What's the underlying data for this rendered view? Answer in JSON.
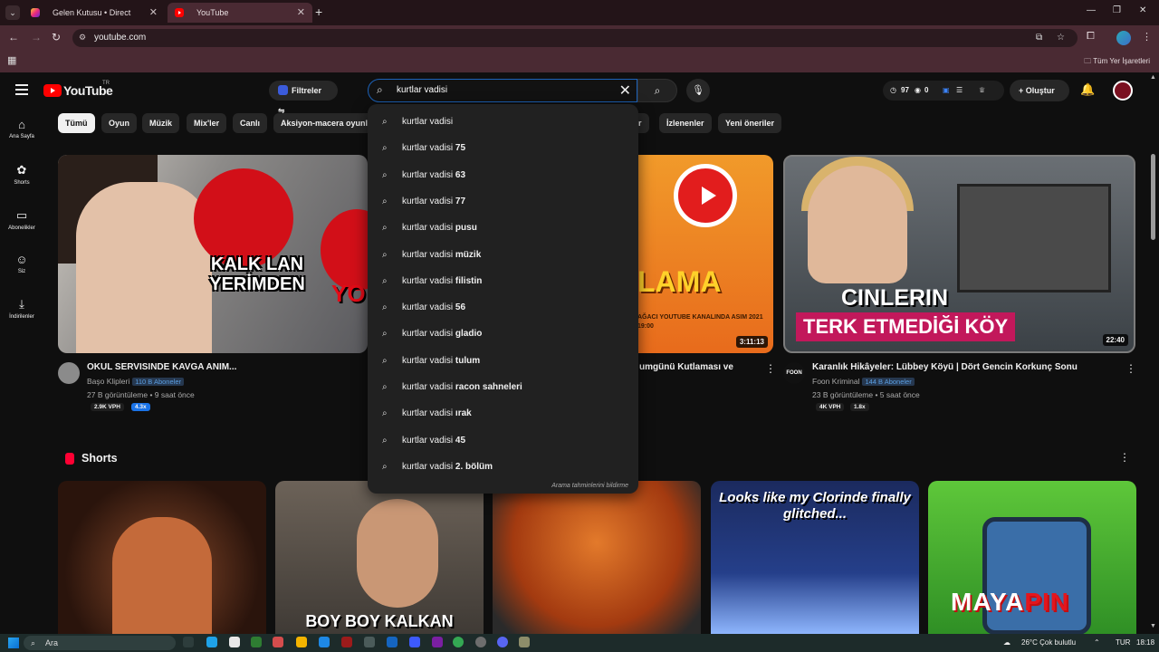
{
  "browser": {
    "tabs": [
      {
        "title": "Gelen Kutusu • Direct",
        "active": false
      },
      {
        "title": "YouTube",
        "active": true
      }
    ],
    "url": "youtube.com",
    "bookmarks_label": "Tüm Yer İşaretleri"
  },
  "youtube": {
    "logo_text": "YouTube",
    "country_code": "TR",
    "filters_label": "Filtreler",
    "search_query": "kurtlar vadisi",
    "ext_stats": {
      "views": "97",
      "eye": "0"
    },
    "create_label": "Oluştur",
    "sidebar": [
      {
        "label": "Ana Sayfa",
        "icon": "home-icon"
      },
      {
        "label": "Shorts",
        "icon": "shorts-icon"
      },
      {
        "label": "Abonelikler",
        "icon": "subscriptions-icon"
      },
      {
        "label": "Siz",
        "icon": "you-icon"
      },
      {
        "label": "İndirilenler",
        "icon": "download-icon"
      }
    ],
    "chips": [
      "Tümü",
      "Oyun",
      "Müzik",
      "Mix'ler",
      "Canlı",
      "Aksiyon-macera oyunları",
      "er",
      "İzlenenler",
      "Yeni öneriler"
    ],
    "videos": [
      {
        "thumb_text": "KALK LAN YERİMDEN",
        "thumb_text2": "YO",
        "title": "OKUL SERVISINDE KAVGA ANIM...",
        "channel": "Başo Klipleri",
        "subs": "110 B Aboneler",
        "stats": "27 B görüntüleme • 9 saat önce",
        "vph": "2.9K VPH",
        "ratio": "4.3x"
      },
      {
        "thumb_text": "LAMA",
        "thumb_sub": "AĞACI YOUTUBE KANALINDA ASIM 2021 19:00",
        "duration": "3:11:13",
        "title": "umgünü Kutlaması ve"
      },
      {
        "thumb_line1": "CINLERIN",
        "thumb_line2": "TERK ETMEDİĞİ KÖY",
        "duration": "22:40",
        "title": "Karanlık Hikâyeler: Lübbey Köyü | Dört Gencin Korkunç Sonu",
        "channel": "Foon Kriminal",
        "channel_logo": "FOON",
        "subs": "144 B Aboneler",
        "stats": "23 B görüntüleme • 5 saat önce",
        "vph": "4K VPH",
        "ratio": "1.8x"
      }
    ],
    "shorts_title": "Shorts",
    "shorts": [
      {
        "caption": ""
      },
      {
        "caption": "BOY BOY KALKAN"
      },
      {
        "caption": ""
      },
      {
        "caption": "Looks like my Clorinde finally glitched..."
      },
      {
        "caption": "",
        "watermark_a": "MAYA",
        "watermark_b": "PIN"
      }
    ],
    "suggestions": [
      {
        "prefix": "kurtlar vadisi",
        "suffix": ""
      },
      {
        "prefix": "kurtlar vadisi",
        "suffix": " 75"
      },
      {
        "prefix": "kurtlar vadisi",
        "suffix": " 63"
      },
      {
        "prefix": "kurtlar vadisi",
        "suffix": " 77"
      },
      {
        "prefix": "kurtlar vadisi",
        "suffix": " pusu"
      },
      {
        "prefix": "kurtlar vadisi",
        "suffix": " müzik"
      },
      {
        "prefix": "kurtlar vadisi",
        "suffix": " filistin"
      },
      {
        "prefix": "kurtlar vadisi",
        "suffix": " 56"
      },
      {
        "prefix": "kurtlar vadisi",
        "suffix": " gladio"
      },
      {
        "prefix": "kurtlar vadisi",
        "suffix": " tulum"
      },
      {
        "prefix": "kurtlar vadisi",
        "suffix": " racon sahneleri"
      },
      {
        "prefix": "kurtlar vadisi",
        "suffix": " ırak"
      },
      {
        "prefix": "kurtlar vadisi",
        "suffix": " 45"
      },
      {
        "prefix": "kurtlar vadisi",
        "suffix": " 2. bölüm"
      }
    ],
    "report_label": "Arama tahminlerini bildirme"
  },
  "taskbar": {
    "search_label": "Ara",
    "weather": "26°C  Çok bulutlu",
    "lang": "TUR",
    "time": "18:18"
  },
  "colors": {
    "tabstrip": "#231418",
    "toolbar": "#4a2a33",
    "yt_bg": "#0f0f0f",
    "yt_red": "#ff0000",
    "search_focus": "#1c62b9"
  }
}
